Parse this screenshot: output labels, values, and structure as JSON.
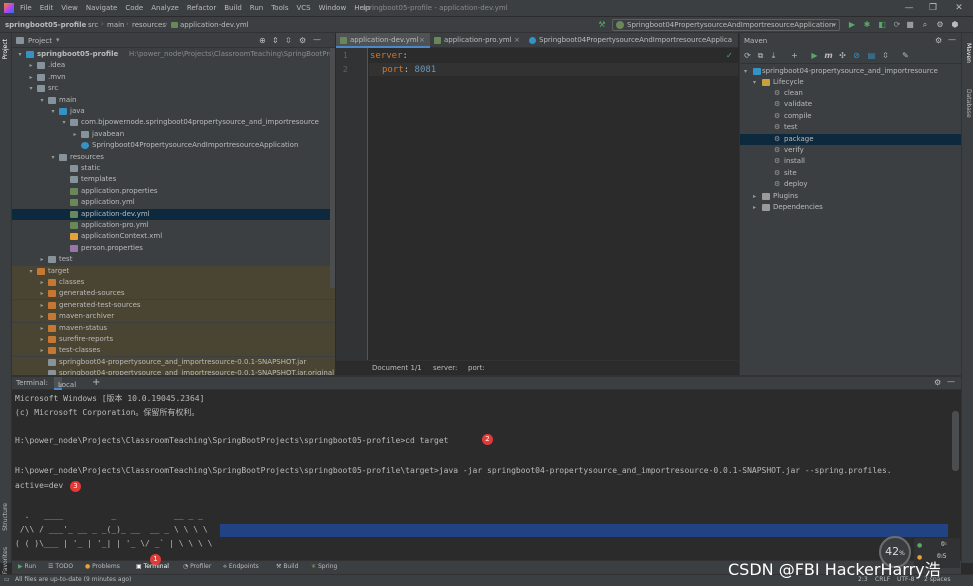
{
  "menu": {
    "items": [
      "File",
      "Edit",
      "View",
      "Navigate",
      "Code",
      "Analyze",
      "Refactor",
      "Build",
      "Run",
      "Tools",
      "VCS",
      "Window",
      "Help"
    ],
    "window_title": "springboot05-profile - application-dev.yml"
  },
  "breadcrumbs": [
    "springboot05-profile",
    "src",
    "main",
    "resources",
    "application-dev.yml"
  ],
  "run_config": "Springboot04PropertysourceAndImportresourceApplication",
  "project_panel": {
    "title": "Project",
    "tree": [
      {
        "label": "springboot05-profile",
        "path": "H:\\power_node\\Projects\\ClassroomTeaching\\SpringBootProjects\\sprin",
        "level": 0,
        "expanded": true,
        "type": "module"
      },
      {
        "label": ".idea",
        "level": 1,
        "expanded": false,
        "type": "folder"
      },
      {
        "label": ".mvn",
        "level": 1,
        "expanded": false,
        "type": "folder"
      },
      {
        "label": "src",
        "level": 1,
        "expanded": true,
        "type": "folder"
      },
      {
        "label": "main",
        "level": 2,
        "expanded": true,
        "type": "folder"
      },
      {
        "label": "java",
        "level": 3,
        "expanded": true,
        "type": "source"
      },
      {
        "label": "com.bjpowernode.springboot04propertysource_and_importresource",
        "level": 4,
        "expanded": true,
        "type": "package"
      },
      {
        "label": "javabean",
        "level": 5,
        "expanded": false,
        "type": "package"
      },
      {
        "label": "Springboot04PropertysourceAndImportresourceApplication",
        "level": 5,
        "type": "class"
      },
      {
        "label": "resources",
        "level": 3,
        "expanded": true,
        "type": "resources"
      },
      {
        "label": "static",
        "level": 4,
        "type": "folder"
      },
      {
        "label": "templates",
        "level": 4,
        "type": "folder"
      },
      {
        "label": "application.properties",
        "level": 4,
        "type": "config"
      },
      {
        "label": "application.yml",
        "level": 4,
        "type": "config"
      },
      {
        "label": "application-dev.yml",
        "level": 4,
        "type": "config",
        "selected": true
      },
      {
        "label": "application-pro.yml",
        "level": 4,
        "type": "config"
      },
      {
        "label": "applicationContext.xml",
        "level": 4,
        "type": "xml"
      },
      {
        "label": "person.properties",
        "level": 4,
        "type": "props"
      },
      {
        "label": "test",
        "level": 2,
        "expanded": false,
        "type": "folder"
      },
      {
        "label": "target",
        "level": 1,
        "expanded": true,
        "type": "excluded",
        "highlight": true
      },
      {
        "label": "classes",
        "level": 2,
        "expanded": false,
        "type": "excluded",
        "highlight": true
      },
      {
        "label": "generated-sources",
        "level": 2,
        "expanded": false,
        "type": "excluded",
        "highlight": true
      },
      {
        "label": "generated-test-sources",
        "level": 2,
        "expanded": false,
        "type": "excluded",
        "highlight": true
      },
      {
        "label": "maven-archiver",
        "level": 2,
        "expanded": false,
        "type": "excluded",
        "highlight": true
      },
      {
        "label": "maven-status",
        "level": 2,
        "expanded": false,
        "type": "excluded",
        "highlight": true
      },
      {
        "label": "surefire-reports",
        "level": 2,
        "expanded": false,
        "type": "excluded",
        "highlight": true
      },
      {
        "label": "test-classes",
        "level": 2,
        "expanded": false,
        "type": "excluded",
        "highlight": true
      },
      {
        "label": "springboot04-propertysource_and_importresource-0.0.1-SNAPSHOT.jar",
        "level": 2,
        "type": "jar",
        "highlight": true
      },
      {
        "label": "springboot04-propertysource_and_importresource-0.0.1-SNAPSHOT.jar.original",
        "level": 2,
        "type": "file",
        "highlight": true
      }
    ]
  },
  "editor": {
    "tabs": [
      {
        "label": "application-dev.yml",
        "active": true
      },
      {
        "label": "application-pro.yml",
        "active": false
      },
      {
        "label": "Springboot04PropertysourceAndImportresourceApplica",
        "active": false
      }
    ],
    "line_numbers": [
      "1",
      "2"
    ],
    "code": {
      "line1_key": "server",
      "line1_colon": ":",
      "line2_key": "port",
      "line2_colon": ": ",
      "line2_value": "8081"
    },
    "status": [
      "Document 1/1",
      "server:",
      "port:"
    ]
  },
  "maven": {
    "title": "Maven",
    "project": "springboot04-propertysource_and_importresource",
    "lifecycle_label": "Lifecycle",
    "lifecycle": [
      "clean",
      "validate",
      "compile",
      "test",
      "package",
      "verify",
      "install",
      "site",
      "deploy"
    ],
    "selected": "package",
    "plugins_label": "Plugins",
    "dependencies_label": "Dependencies"
  },
  "terminal": {
    "tab_label": "Terminal:",
    "local_tab": "Local",
    "lines": [
      "Microsoft Windows [版本 10.0.19045.2364]",
      "(c) Microsoft Corporation。保留所有权利。",
      "",
      "H:\\power_node\\Projects\\ClassroomTeaching\\SpringBootProjects\\springboot05-profile>cd target",
      "",
      "H:\\power_node\\Projects\\ClassroomTeaching\\SpringBootProjects\\springboot05-profile\\target>java -jar springboot04-propertysource_and_importresource-0.0.1-SNAPSHOT.jar --spring.profiles.",
      "active=dev",
      "",
      "  .   ____          _            __ _ _",
      " /\\\\ / ___'_ __ _ _(_)_ __  __ _ \\ \\ \\ \\",
      "( ( )\\___ | '_ | '_| | '_ \\/ _` | \\ \\ \\ \\"
    ],
    "badges": [
      "1",
      "2",
      "3"
    ]
  },
  "bottom_tabs": [
    "Run",
    "TODO",
    "Problems",
    "Terminal",
    "Profiler",
    "Endpoints",
    "Build",
    "Spring"
  ],
  "side_tabs": {
    "left_top": "Project",
    "left_structure": "Structure",
    "left_favorites": "Favorites",
    "right_maven": "Maven",
    "right_database": "Database"
  },
  "status_bar": {
    "message": "All files are up-to-date (9 minutes ago)",
    "position": "2:3",
    "line_ending": "CRLF",
    "encoding": "UTF-8",
    "indent": "2 spaces"
  },
  "widget": {
    "cpu": "42",
    "cpu_unit": "%",
    "net_up": "0",
    "net_up_unit": "K/s",
    "net_down": "0.5",
    "net_down_unit": "K/s"
  },
  "watermark": "CSDN @FBI HackerHarry浩",
  "colors": {
    "accent": "#4a88c7",
    "keyword": "#cc7832",
    "number": "#6897bb",
    "badge": "#e53935",
    "selection": "#214283",
    "excluded": "#4a4432"
  }
}
